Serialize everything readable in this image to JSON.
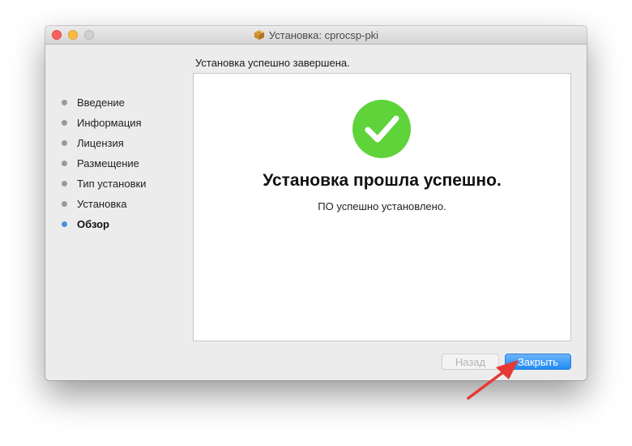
{
  "window": {
    "title": "Установка: cprocsp-pki"
  },
  "header": {
    "status_text": "Установка успешно завершена."
  },
  "sidebar": {
    "steps": [
      {
        "label": "Введение",
        "active": false
      },
      {
        "label": "Информация",
        "active": false
      },
      {
        "label": "Лицензия",
        "active": false
      },
      {
        "label": "Размещение",
        "active": false
      },
      {
        "label": "Тип установки",
        "active": false
      },
      {
        "label": "Установка",
        "active": false
      },
      {
        "label": "Обзор",
        "active": true
      }
    ]
  },
  "main": {
    "icon": "checkmark-success-icon",
    "success_title": "Установка прошла успешно.",
    "success_subtitle": "ПО успешно установлено."
  },
  "buttons": {
    "back_label": "Назад",
    "back_enabled": false,
    "close_label": "Закрыть"
  },
  "colors": {
    "accent": "#1f8cf6",
    "success_green": "#5fd33a",
    "annotation_arrow": "#e53935"
  }
}
